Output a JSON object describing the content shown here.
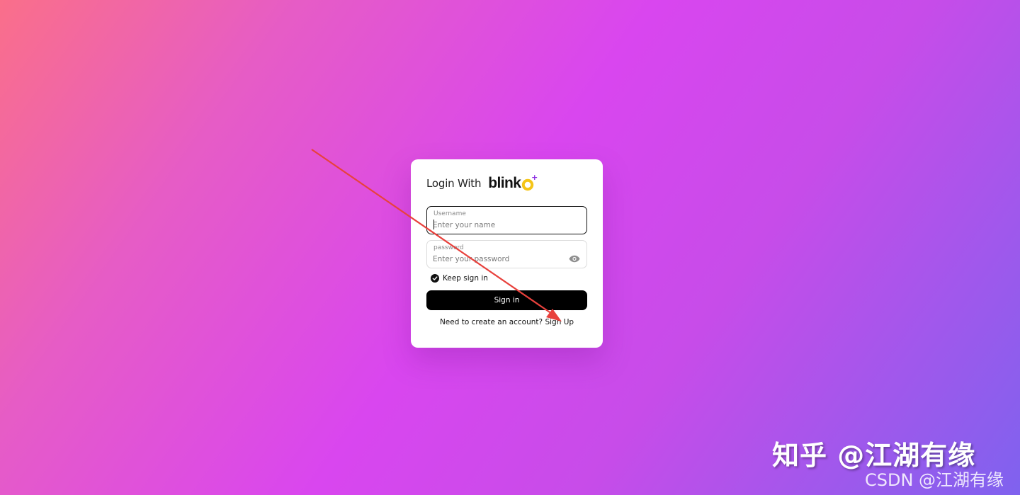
{
  "colors": {
    "background_start": "#fa6f8a",
    "background_mid": "#d946ef",
    "background_end": "#7f62ee",
    "card": "#ffffff",
    "button": "#000000",
    "logo_accent": "#f5c518",
    "logo_plus": "#8a2be2",
    "annotation_arrow": "#e8413c"
  },
  "login": {
    "title": "Login With",
    "logo_text": "blink",
    "logo_icon": "blinko-logo-o",
    "logo_plus": "+"
  },
  "username": {
    "label": "Username",
    "placeholder": "Enter your name",
    "value": ""
  },
  "password": {
    "label": "password",
    "placeholder": "Enter your password",
    "value": "",
    "toggle_icon": "eye-icon"
  },
  "keep_signed_in": {
    "label": "Keep sign in",
    "checked": true
  },
  "sign_in_button": {
    "label": "Sign in"
  },
  "signup": {
    "prompt": "Need to create an account?",
    "link": "Sign Up"
  },
  "watermark": {
    "main": "知乎 @江湖有缘",
    "sub": "CSDN @江湖有缘"
  }
}
